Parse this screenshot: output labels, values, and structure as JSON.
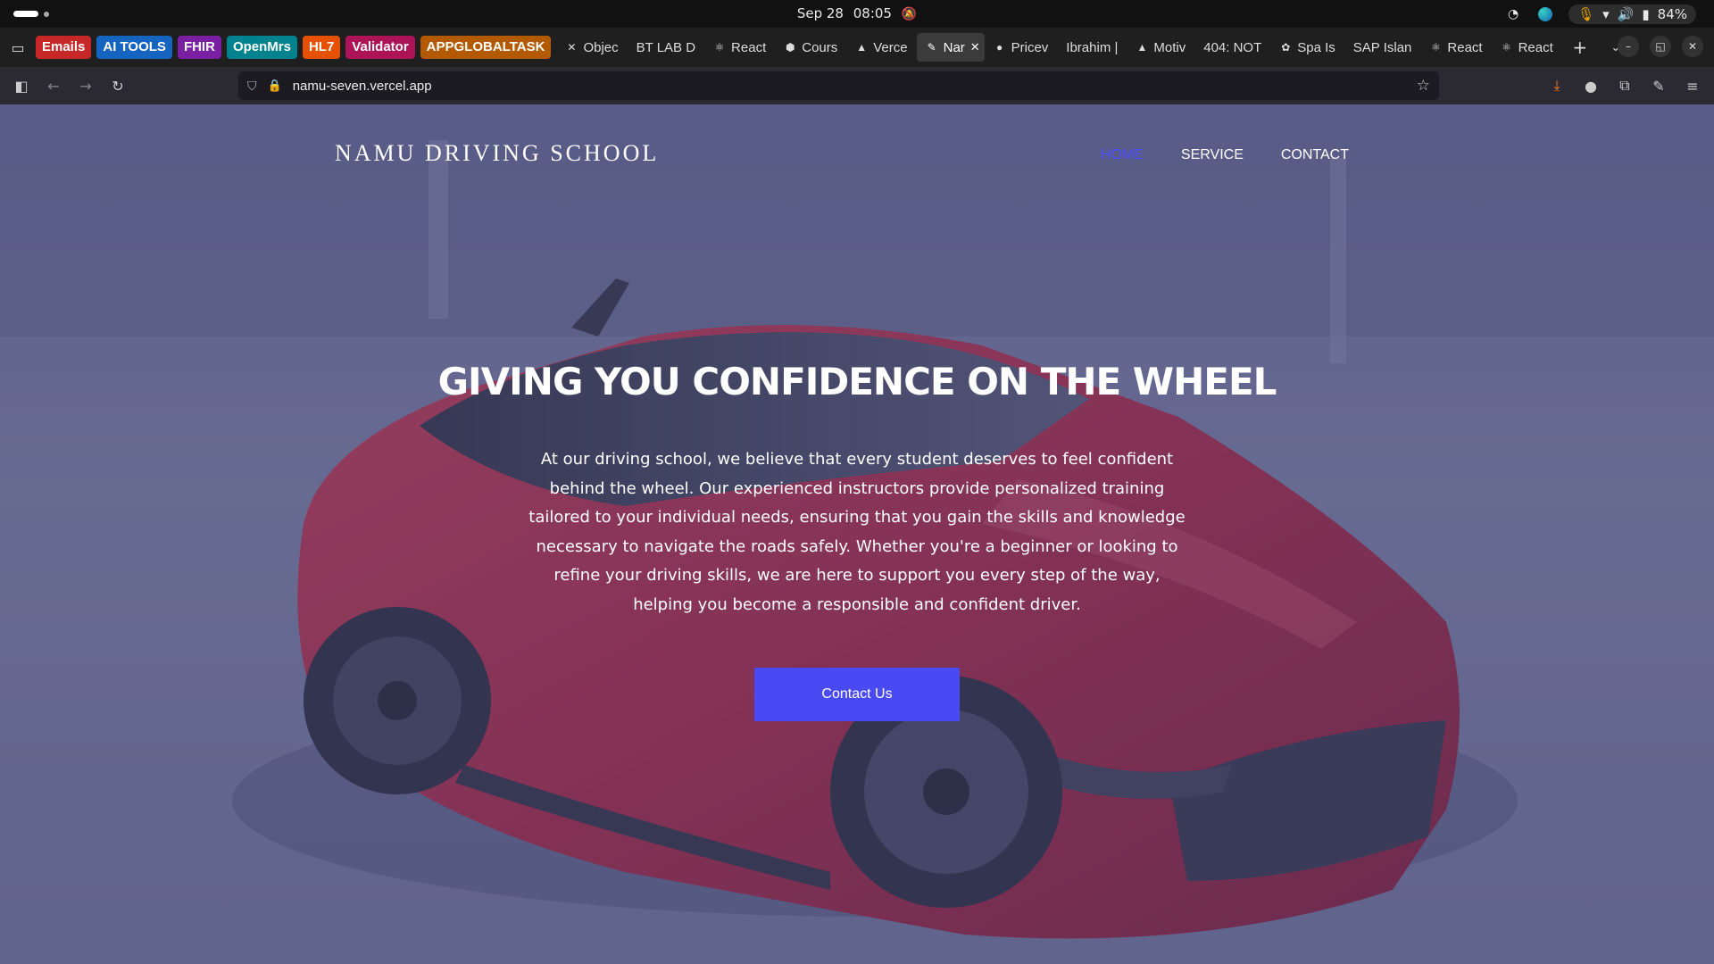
{
  "os": {
    "date": "Sep 28",
    "time": "08:05",
    "battery": "84%"
  },
  "bookmarks": [
    {
      "label": "Emails",
      "color": "#c62828"
    },
    {
      "label": "AI TOOLS",
      "color": "#1565c0"
    },
    {
      "label": "FHIR",
      "color": "#7b1fa2"
    },
    {
      "label": "OpenMrs",
      "color": "#00838f"
    },
    {
      "label": "HL7",
      "color": "#e65100"
    },
    {
      "label": "Validator",
      "color": "#ad1457"
    },
    {
      "label": "APPGLOBALTASK",
      "color": "#b35900"
    }
  ],
  "tabs": [
    {
      "label": "Objec",
      "icon": "figma-icon"
    },
    {
      "label": "BT LAB D",
      "icon": ""
    },
    {
      "label": "React",
      "icon": "react-icon"
    },
    {
      "label": "Cours",
      "icon": "course-icon"
    },
    {
      "label": "Verce",
      "icon": "vercel-icon"
    },
    {
      "label": "Nar",
      "icon": "page-icon",
      "active": true
    },
    {
      "label": "Pricev",
      "icon": "price-icon"
    },
    {
      "label": "Ibrahim |",
      "icon": ""
    },
    {
      "label": "Motiv",
      "icon": "vercel-icon"
    },
    {
      "label": "404: NOT",
      "icon": ""
    },
    {
      "label": "Spa Is",
      "icon": "spa-icon"
    },
    {
      "label": "SAP Islan",
      "icon": ""
    },
    {
      "label": "React",
      "icon": "react-icon"
    },
    {
      "label": "React",
      "icon": "react-icon"
    }
  ],
  "browser": {
    "url": "namu-seven.vercel.app"
  },
  "site": {
    "brand": "NAMU DRIVING SCHOOL",
    "nav": {
      "home": "HOME",
      "service": "SERVICE",
      "contact": "CONTACT"
    },
    "hero": {
      "title": "GIVING YOU CONFIDENCE ON THE WHEEL",
      "body": "At our driving school, we believe that every student deserves to feel confident behind the wheel. Our experienced instructors provide personalized training tailored to your individual needs, ensuring that you gain the skills and knowledge necessary to navigate the roads safely. Whether you're a beginner or looking to refine your driving skills, we are here to support you every step of the way, helping you become a responsible and confident driver.",
      "cta": "Contact Us"
    },
    "colors": {
      "accent": "#4a4af4",
      "active_nav": "#4b4dff",
      "car": "#b0253a"
    }
  }
}
